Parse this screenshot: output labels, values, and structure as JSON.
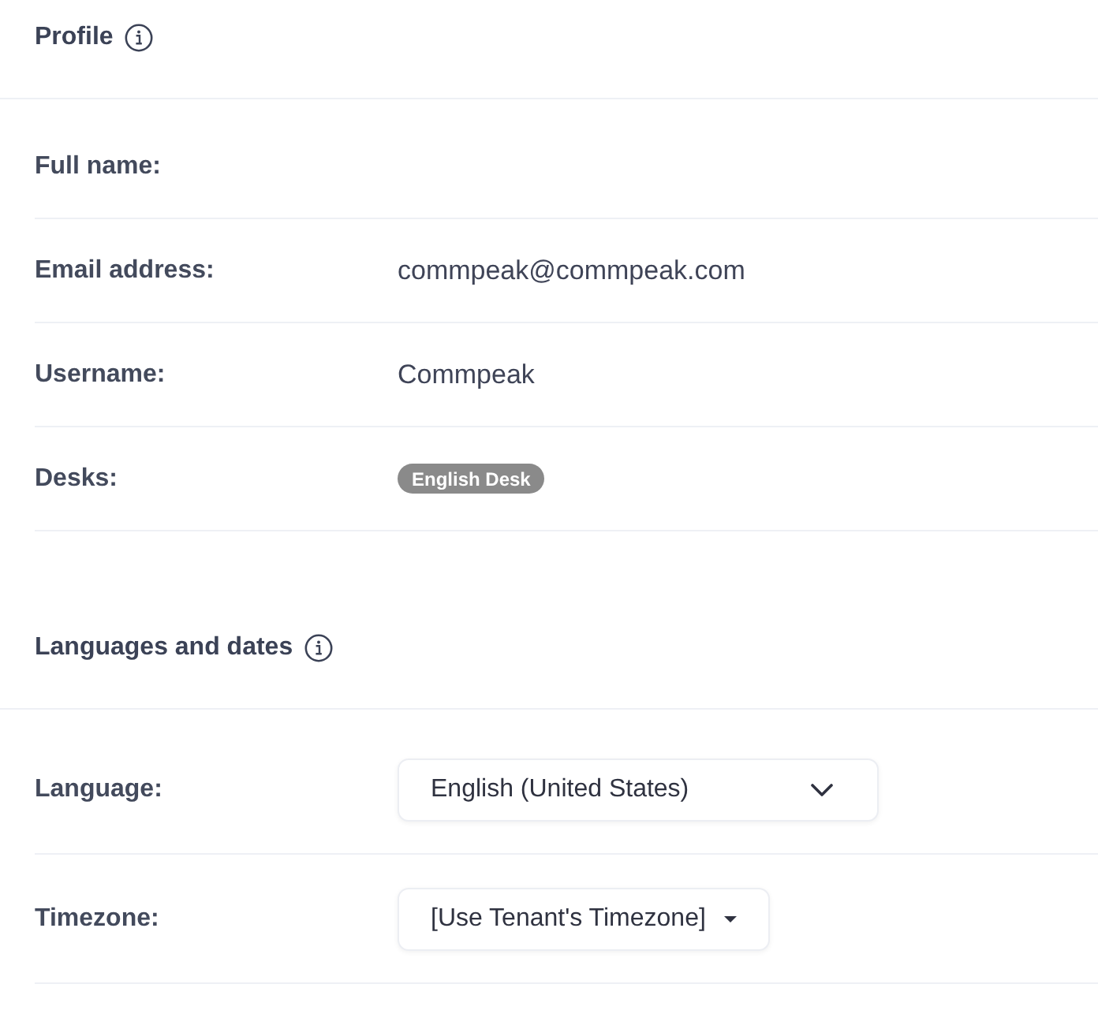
{
  "sections": [
    {
      "title": "Profile",
      "fields": [
        {
          "label": "Full name:",
          "kind": "text"
        },
        {
          "label": "Email address:",
          "kind": "text",
          "value": "commpeak@commpeak.com"
        },
        {
          "label": "Username:",
          "kind": "text",
          "value": "Commpeak"
        },
        {
          "label": "Desks:",
          "kind": "tags",
          "tags": [
            "English Desk"
          ]
        }
      ]
    },
    {
      "title": "Languages and dates",
      "fields": [
        {
          "label": "Language:",
          "kind": "select",
          "value": "English (United States)"
        },
        {
          "label": "Timezone:",
          "kind": "dropdown",
          "value": "[Use Tenant's Timezone]"
        }
      ]
    }
  ]
}
